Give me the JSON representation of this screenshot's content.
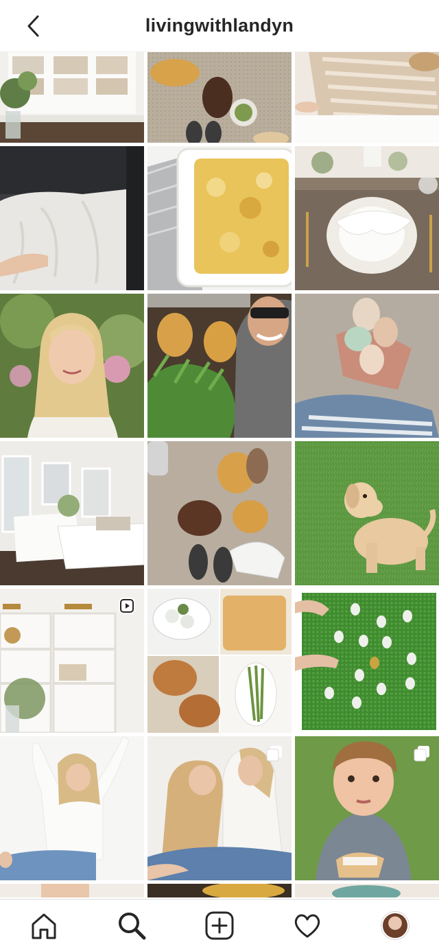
{
  "header": {
    "title": "livingwithlandyn",
    "back_icon": "chevron-left-icon"
  },
  "grid": {
    "posts": [
      {
        "kind": "image",
        "badge": ""
      },
      {
        "kind": "image",
        "badge": ""
      },
      {
        "kind": "image",
        "badge": ""
      },
      {
        "kind": "image",
        "badge": ""
      },
      {
        "kind": "image",
        "badge": ""
      },
      {
        "kind": "image",
        "badge": ""
      },
      {
        "kind": "image",
        "badge": ""
      },
      {
        "kind": "image",
        "badge": ""
      },
      {
        "kind": "image",
        "badge": ""
      },
      {
        "kind": "image",
        "badge": ""
      },
      {
        "kind": "image",
        "badge": ""
      },
      {
        "kind": "image",
        "badge": ""
      },
      {
        "kind": "image",
        "badge": "reels-icon"
      },
      {
        "kind": "image",
        "badge": ""
      },
      {
        "kind": "image",
        "badge": ""
      },
      {
        "kind": "image",
        "badge": ""
      },
      {
        "kind": "carousel",
        "badge": "carousel-icon"
      },
      {
        "kind": "carousel",
        "badge": "carousel-icon"
      }
    ]
  },
  "bottom_nav": {
    "items": [
      {
        "icon": "home-icon"
      },
      {
        "icon": "search-icon"
      },
      {
        "icon": "new-post-icon"
      },
      {
        "icon": "heart-icon"
      },
      {
        "icon": "profile-avatar"
      }
    ]
  },
  "colors": {
    "text": "#262626",
    "background": "#ffffff",
    "divider": "#dbdbdb"
  }
}
